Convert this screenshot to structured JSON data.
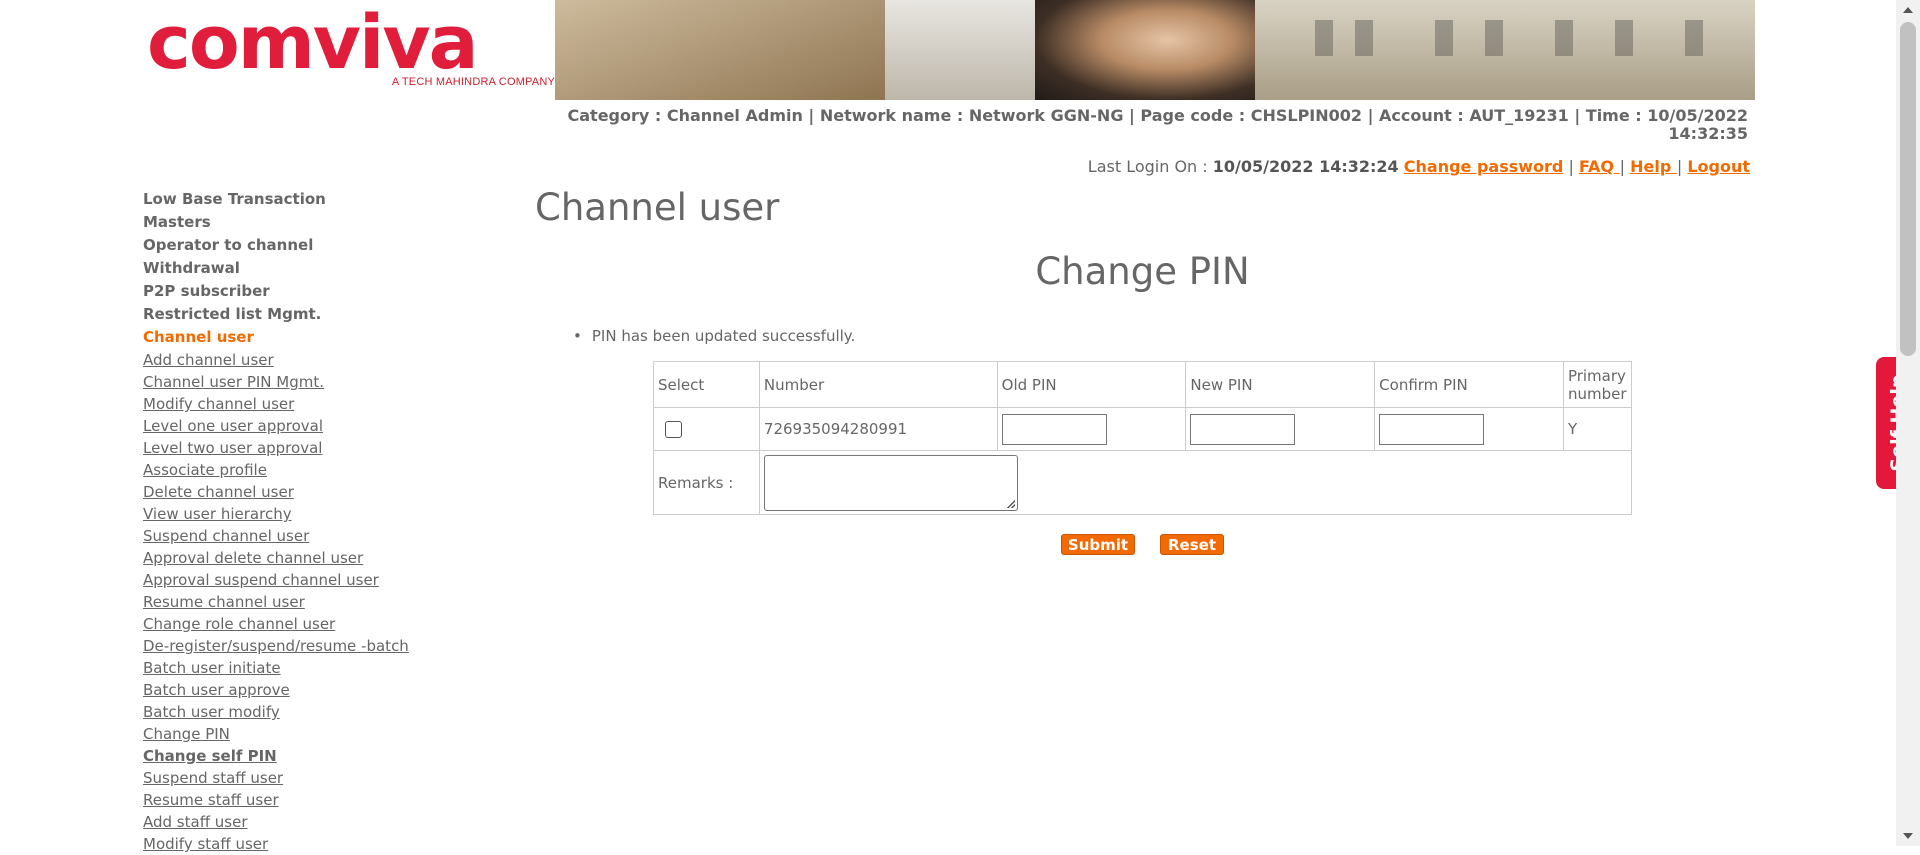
{
  "header": {
    "logo_text": "comviva",
    "logo_tagline": "A TECH MAHINDRA COMPANY",
    "info_line": "Category : Channel Admin | Network name : Network GGN-NG | Page code : CHSLPIN002 | Account : AUT_19231 | Time : 10/05/2022 14:32:35",
    "last_login_label": "Last Login On :",
    "last_login_value": "10/05/2022 14:32:24",
    "links": {
      "change_password": "Change password",
      "faq": "FAQ ",
      "help": "Help ",
      "logout": "Logout"
    },
    "separator": "|"
  },
  "sidebar": {
    "categories": [
      "Low Base Transaction",
      "Masters",
      "Operator to channel",
      "Withdrawal",
      "P2P subscriber",
      "Restricted list Mgmt.",
      "Channel user"
    ],
    "items": [
      "Add channel user",
      "Channel user PIN Mgmt.",
      "Modify channel user",
      "Level one user approval",
      "Level two user approval",
      "Associate profile",
      "Delete channel user",
      "View user hierarchy",
      "Suspend channel user",
      "Approval delete channel user",
      "Approval suspend channel user",
      "Resume channel user",
      "Change role channel user",
      "De-register/suspend/resume -batch",
      "Batch user initiate",
      "Batch user approve",
      "Batch user modify",
      "Change PIN",
      "Change self PIN",
      "Suspend staff user",
      "Resume staff user",
      "Add staff user",
      "Modify staff user"
    ]
  },
  "main": {
    "page_title": "Channel user",
    "section_title": "Change PIN",
    "message": "PIN has been updated successfully.",
    "table": {
      "headers": [
        "Select",
        "Number",
        "Old PIN",
        "New PIN",
        "Confirm PIN",
        "Primary number"
      ],
      "row": {
        "number": "726935094280991",
        "primary": "Y"
      },
      "remarks_label": "Remarks :"
    },
    "buttons": {
      "submit": "Submit",
      "reset": "Reset"
    }
  },
  "self_help": "Self Help",
  "colors": {
    "accent": "#f26a00",
    "brand_red": "#e3183b",
    "text": "#666666"
  }
}
